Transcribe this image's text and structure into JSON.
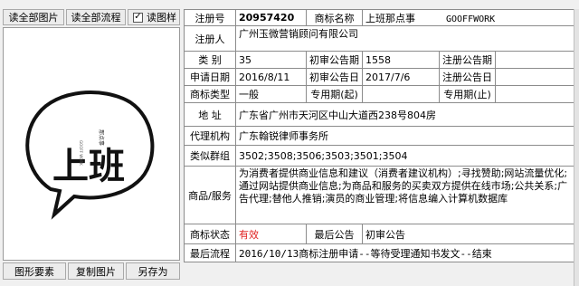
{
  "toolbar": {
    "read_all_images": "读全部图片",
    "read_all_flow": "读全部流程",
    "read_image_checkbox": {
      "label": "读图样",
      "checked": true
    }
  },
  "bottom_buttons": {
    "graphic_elements": "图形要素",
    "copy_image": "复制图片",
    "save_as": "另存为"
  },
  "record": {
    "reg_no_label": "注册号",
    "reg_no": "20957420",
    "mark_name_label": "商标名称",
    "mark_name": "上班那点事",
    "mark_name_en": "GOOFFWORK",
    "registrant_label": "注册人",
    "registrant": "广州玉微营销顾问有限公司",
    "class_label": "类  别",
    "class": "35",
    "prelim_issue_label": "初审公告期",
    "prelim_issue": "1558",
    "reg_issue_label": "注册公告期",
    "reg_issue": "",
    "apply_date_label": "申请日期",
    "apply_date": "2016/8/11",
    "prelim_date_label": "初审公告日",
    "prelim_date": "2017/7/6",
    "reg_date_label": "注册公告日",
    "reg_date": "",
    "mark_type_label": "商标类型",
    "mark_type": "一般",
    "excl_start_label": "专用期(起)",
    "excl_start": "",
    "excl_end_label": "专用期(止)",
    "excl_end": "",
    "address_label": "地  址",
    "address": "广东省广州市天河区中山大道西238号804房",
    "agent_label": "代理机构",
    "agent": "广东翰锐律师事务所",
    "group_label": "类似群组",
    "group": "3502;3508;3506;3503;3501;3504",
    "goods_label": "商品/服务",
    "goods": "为消费者提供商业信息和建议（消费者建议机构）;寻找赞助;网站流量优化;通过网站提供商业信息;为商品和服务的买卖双方提供在线市场;公共关系;广告代理;替他人推销;演员的商业管理;将信息编入计算机数据库",
    "status_label": "商标状态",
    "status": "有效",
    "latest_notice_label": "最后公告",
    "latest_notice": "初审公告",
    "latest_flow_label": "最后流程",
    "latest_flow": "2016/10/13商标注册申请--等待受理通知书发文--结束"
  },
  "logo": {
    "main_text": "上班",
    "small_text": "那点事",
    "side_text": "GOOFF WORK"
  },
  "colors": {
    "status_active": "#e02020",
    "frame_bg": "#f0f0f0"
  }
}
